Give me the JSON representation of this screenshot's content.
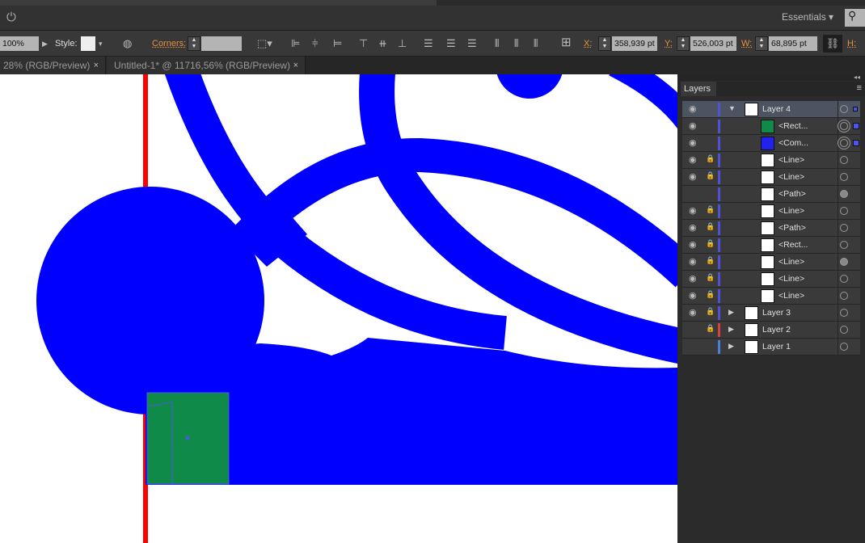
{
  "menubar": {
    "workspace": "Essentials"
  },
  "control": {
    "opacity": "100%",
    "style_label": "Style:",
    "corners_label": "Corners:",
    "x_label": "X:",
    "x_value": "358,939 pt",
    "y_label": "Y:",
    "y_value": "526,003 pt",
    "w_label": "W:",
    "w_value": "68,895 pt",
    "h_label": "H:"
  },
  "tabs": [
    {
      "label": "28% (RGB/Preview)"
    },
    {
      "label": "Untitled-1* @ 11716,56% (RGB/Preview)"
    }
  ],
  "close_glyph": "×",
  "layers": {
    "title": "Layers",
    "collapse": "◂◂",
    "rows": [
      {
        "name": "Layer 4",
        "visible": true,
        "locked": false,
        "level": 0,
        "expand": "▼",
        "color": "#5050d8",
        "selected": true
      },
      {
        "name": "<Rect...",
        "visible": true,
        "locked": false,
        "level": 1,
        "color": "#5050d8",
        "thumb": "#0f8a48",
        "target": "double",
        "sq": true
      },
      {
        "name": "<Com...",
        "visible": true,
        "locked": false,
        "level": 1,
        "color": "#5050d8",
        "thumb": "#2222ee",
        "target": "double",
        "sq": true
      },
      {
        "name": "<Line>",
        "visible": true,
        "locked": true,
        "level": 1,
        "color": "#5050d8"
      },
      {
        "name": "<Line>",
        "visible": true,
        "locked": true,
        "level": 1,
        "color": "#5050d8"
      },
      {
        "name": "<Path>",
        "visible": false,
        "locked": false,
        "level": 1,
        "color": "#5050d8",
        "target": "filled"
      },
      {
        "name": "<Line>",
        "visible": true,
        "locked": true,
        "level": 1,
        "color": "#5050d8"
      },
      {
        "name": "<Path>",
        "visible": true,
        "locked": true,
        "level": 1,
        "color": "#5050d8"
      },
      {
        "name": "<Rect...",
        "visible": true,
        "locked": true,
        "level": 1,
        "color": "#5050d8"
      },
      {
        "name": "<Line>",
        "visible": true,
        "locked": true,
        "level": 1,
        "color": "#5050d8",
        "target": "filled"
      },
      {
        "name": "<Line>",
        "visible": true,
        "locked": true,
        "level": 1,
        "color": "#5050d8"
      },
      {
        "name": "<Line>",
        "visible": true,
        "locked": true,
        "level": 1,
        "color": "#5050d8"
      },
      {
        "name": "Layer 3",
        "visible": true,
        "locked": true,
        "level": 0,
        "expand": "▶",
        "color": "#5050d8"
      },
      {
        "name": "Layer 2",
        "visible": false,
        "locked": true,
        "level": 0,
        "expand": "▶",
        "color": "#d84040"
      },
      {
        "name": "Layer 1",
        "visible": false,
        "locked": false,
        "level": 0,
        "expand": "▶",
        "color": "#4a7fd8"
      }
    ]
  },
  "colors": {
    "art_blue": "#0000ff",
    "rect_green": "#0f8a48",
    "guide_red": "#ff0000"
  }
}
